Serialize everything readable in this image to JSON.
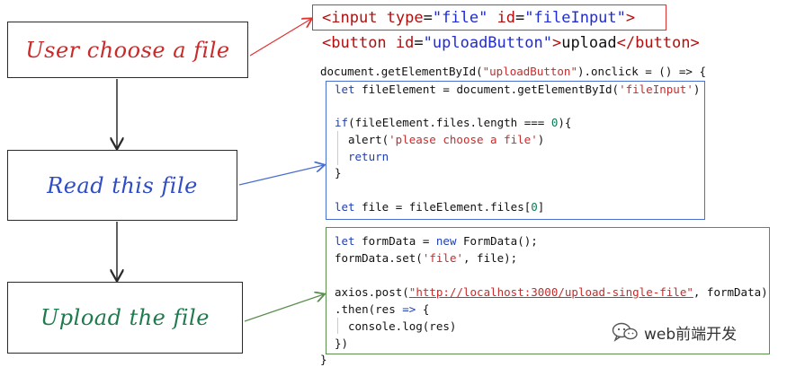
{
  "steps": [
    {
      "label": "User choose a file"
    },
    {
      "label": "Read this file"
    },
    {
      "label": "Upload the file"
    }
  ],
  "html_snippet": {
    "input_tag": "input",
    "input_attr1": "type",
    "input_val1": "\"file\"",
    "input_attr2": "id",
    "input_val2": "\"fileInput\"",
    "button_tag": "button",
    "button_attr": "id",
    "button_val": "\"uploadButton\"",
    "button_text": "upload",
    "button_close": "</button>"
  },
  "js": {
    "l1a": "document.getElementById(",
    "l1b": "\"uploadButton\"",
    "l1c": ").onclick = () => {",
    "l2a": "let",
    "l2b": " fileElement = document.getElementById(",
    "l2c": "'fileInput'",
    "l2d": ")",
    "l3a": "if",
    "l3b": "(fileElement.files.length === ",
    "l3c": "0",
    "l3d": "){",
    "l4a": "alert(",
    "l4b": "'please choose a file'",
    "l4c": ")",
    "l5": "return",
    "l6": "}",
    "l7a": "let",
    "l7b": " file = fileElement.files[",
    "l7c": "0",
    "l7d": "]",
    "l8a": "let",
    "l8b": " formData = ",
    "l8c": "new",
    "l8d": " FormData();",
    "l9a": "formData.set(",
    "l9b": "'file'",
    "l9c": ", file);",
    "l10a": "axios.post(",
    "l10b": "\"http://localhost:3000/upload-single-file\"",
    "l10c": ", formData)",
    "l11a": ".then(res ",
    "l11b": "=>",
    "l11c": " {",
    "l12": "console.log(res)",
    "l13": "})",
    "l14": "}"
  },
  "watermark": {
    "text": "web前端开发"
  },
  "colors": {
    "step1": "#c92a2a",
    "step2": "#2f4cc4",
    "step3": "#1f7a4d",
    "html_box": "#e03131",
    "read_box": "#4a6fd1",
    "upload_box": "#5a8f4e"
  }
}
